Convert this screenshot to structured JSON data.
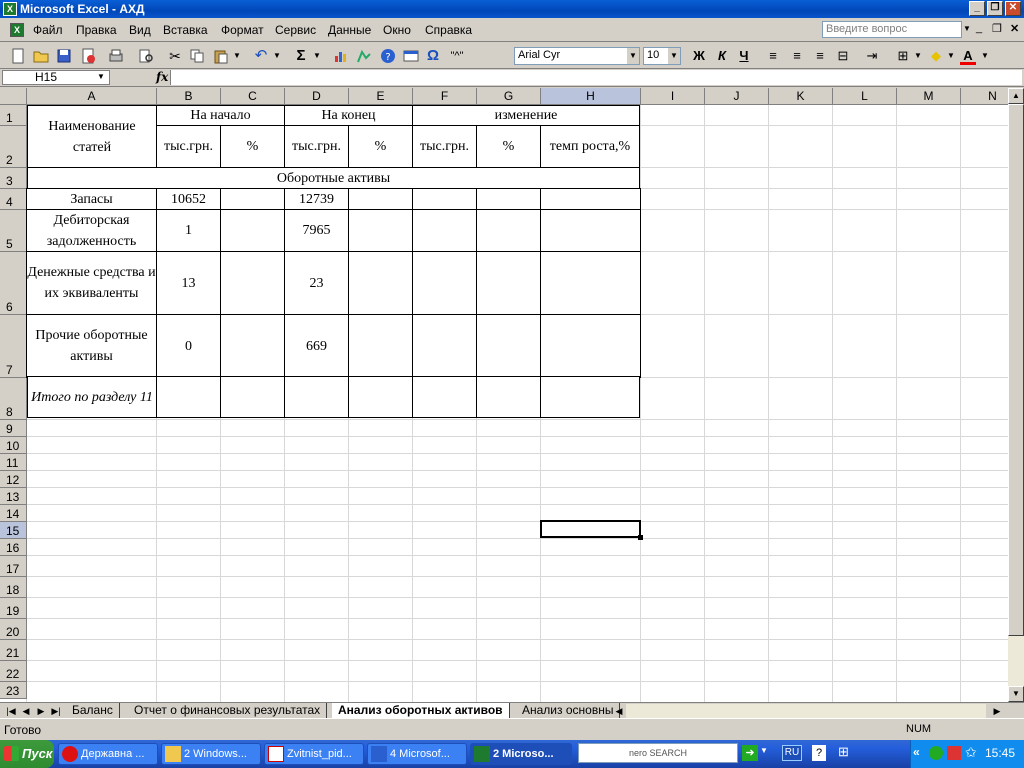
{
  "window": {
    "title": "Microsoft Excel - АХД",
    "buttons": {
      "minimize": "_",
      "restore": "❐",
      "close": "✕"
    },
    "doc_restore": "❐",
    "doc_close": "✕"
  },
  "menu": {
    "items": [
      "Файл",
      "Правка",
      "Вид",
      "Вставка",
      "Формат",
      "Сервис",
      "Данные",
      "Окно",
      "Справка"
    ],
    "ask_placeholder": "Введите вопрос"
  },
  "toolbar": {
    "sigma": "Σ",
    "omega": "Ω",
    "quote": "\"^\"",
    "font_name": "Arial Cyr",
    "font_size": "10",
    "bold": "Ж",
    "italic": "К",
    "underline": "Ч",
    "font_color_letter": "A"
  },
  "formula_bar": {
    "name_box": "H15",
    "fx": "fx",
    "value": ""
  },
  "columns": [
    "A",
    "B",
    "C",
    "D",
    "E",
    "F",
    "G",
    "H",
    "I",
    "J",
    "K",
    "L",
    "M",
    "N"
  ],
  "rows": [
    "1",
    "2",
    "3",
    "4",
    "5",
    "6",
    "7",
    "8",
    "9",
    "10",
    "11",
    "12",
    "13",
    "14",
    "15",
    "16",
    "17",
    "18",
    "19",
    "20",
    "21",
    "22",
    "23"
  ],
  "table": {
    "header_name": "Наименование статей",
    "group_start": "На начало",
    "group_end": "На конец",
    "group_change": "изменение",
    "unit_thousands": "тыс.грн.",
    "unit_percent": "%",
    "growth_rate": "темп роста,%",
    "section_title": "Оборотные активы",
    "rows": [
      {
        "name": "Запасы",
        "start": "10652",
        "end": "12739"
      },
      {
        "name": "Дебиторская задолженность",
        "start": "1",
        "end": "7965"
      },
      {
        "name": "Денежные средства и их эквиваленты",
        "start": "13",
        "end": "23"
      },
      {
        "name": "Прочие оборотные активы",
        "start": "0",
        "end": "669"
      }
    ],
    "total_label": "Итого по разделу 11"
  },
  "sheets": {
    "tabs": [
      "Баланс",
      "Отчет о финансовых результатах",
      "Анализ оборотных активов",
      "Анализ основны"
    ],
    "active_index": 2
  },
  "status": {
    "left": "Готово",
    "num": "NUM"
  },
  "taskbar": {
    "start": "Пуск",
    "tasks": [
      "Державна ...",
      "2 Windows...",
      "Zvitnist_pid...",
      "4 Microsof...",
      "2 Microso..."
    ],
    "search_brand": "nero SEARCH",
    "lang": "RU",
    "clock": "15:45",
    "chevron": "«"
  }
}
